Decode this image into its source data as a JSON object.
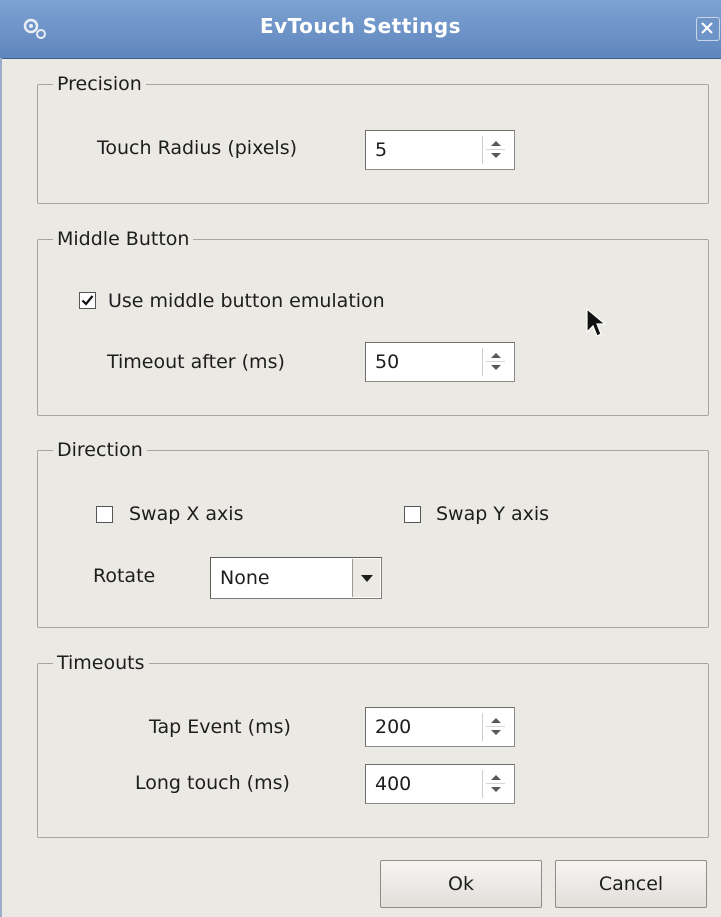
{
  "window": {
    "title": "EvTouch Settings"
  },
  "precision": {
    "legend": "Precision",
    "touch_radius_label": "Touch Radius (pixels)",
    "touch_radius_value": "5"
  },
  "middle_button": {
    "legend": "Middle Button",
    "emulation_label": "Use middle button emulation",
    "emulation_checked": true,
    "timeout_label": "Timeout after (ms)",
    "timeout_value": "50"
  },
  "direction": {
    "legend": "Direction",
    "swap_x_label": "Swap X axis",
    "swap_x_checked": false,
    "swap_y_label": "Swap Y axis",
    "swap_y_checked": false,
    "rotate_label": "Rotate",
    "rotate_value": "None"
  },
  "timeouts": {
    "legend": "Timeouts",
    "tap_label": "Tap Event (ms)",
    "tap_value": "200",
    "long_label": "Long touch (ms)",
    "long_value": "400"
  },
  "buttons": {
    "ok": "Ok",
    "cancel": "Cancel"
  },
  "icons": {
    "app": "gears-icon",
    "close": "close-icon",
    "cursor": "mouse-pointer-icon",
    "check": "checkmark-icon"
  },
  "colors": {
    "titlebar": "#6f95c8",
    "background": "#ebe9e4"
  }
}
